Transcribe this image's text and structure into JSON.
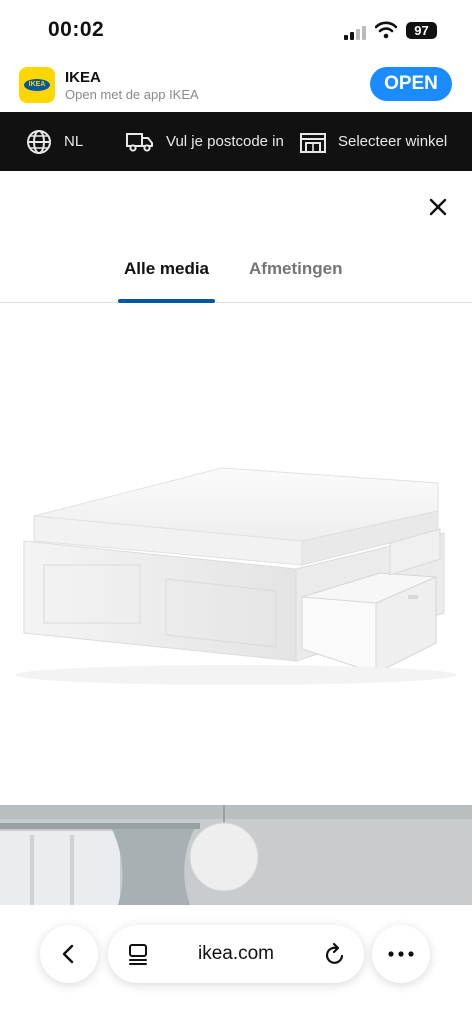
{
  "status_bar": {
    "time": "00:02",
    "battery": "97"
  },
  "app_banner": {
    "name": "IKEA",
    "subtitle": "Open met de app IKEA",
    "open_label": "OPEN",
    "logo_text": "IKEA"
  },
  "nav": {
    "language": "NL",
    "postcode": "Vul je postcode in",
    "store": "Selecteer winkel"
  },
  "sheet": {
    "tabs": [
      {
        "label": "Alle media",
        "active": true
      },
      {
        "label": "Afmetingen",
        "active": false
      }
    ]
  },
  "browser": {
    "url": "ikea.com"
  },
  "colors": {
    "ikea_blue": "#0058a3",
    "ikea_yellow": "#ffd600",
    "open_button": "#1a8cff",
    "nav_bg": "#111111"
  }
}
